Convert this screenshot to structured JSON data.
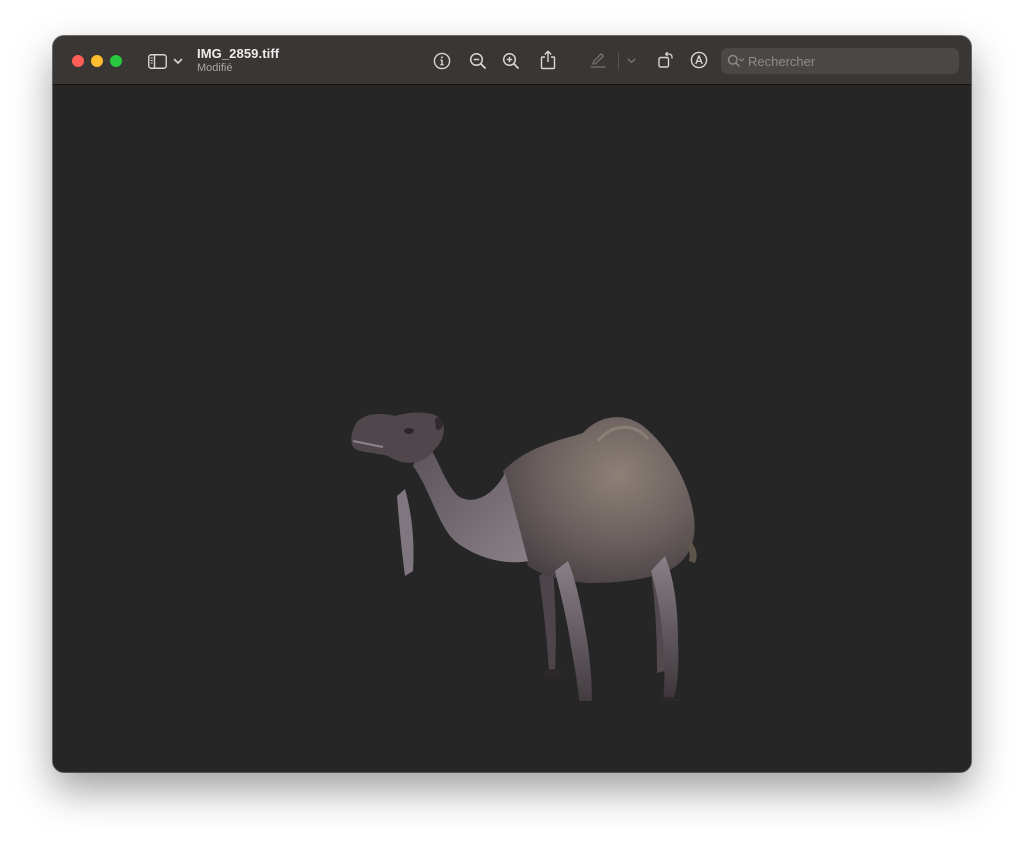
{
  "window": {
    "title": "IMG_2859.tiff",
    "subtitle": "Modifié"
  },
  "traffic_lights": {
    "close_color": "#ff5f57",
    "minimize_color": "#febc2e",
    "zoom_color": "#28c840"
  },
  "toolbar": {
    "icons": [
      "sidebar-icon",
      "chevron-down-icon",
      "info-icon",
      "zoom-out-icon",
      "zoom-in-icon",
      "share-icon",
      "markup-pen-icon",
      "markup-chevron-down-icon",
      "rotate-icon",
      "annotate-icon",
      "search-icon"
    ]
  },
  "search": {
    "placeholder": "Rechercher",
    "value": ""
  },
  "image": {
    "subject": "camel",
    "background_color": "#262626"
  }
}
